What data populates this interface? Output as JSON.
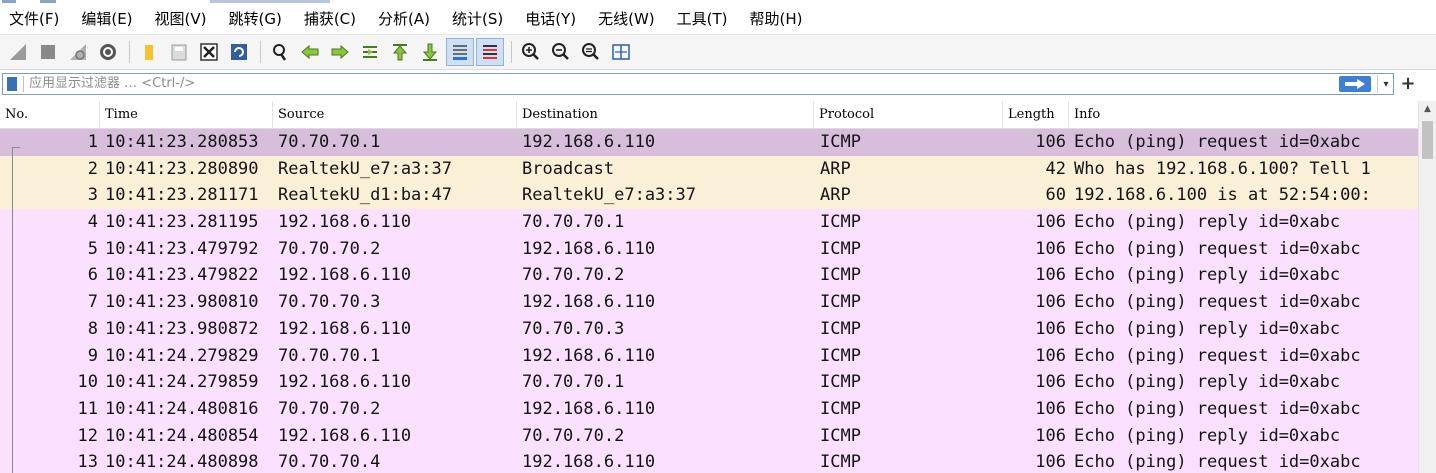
{
  "menu": [
    "文件(F)",
    "编辑(E)",
    "视图(V)",
    "跳转(G)",
    "捕获(C)",
    "分析(A)",
    "统计(S)",
    "电话(Y)",
    "无线(W)",
    "工具(T)",
    "帮助(H)"
  ],
  "toolbar": {
    "buttons": [
      "start-capture-icon",
      "stop-capture-icon",
      "restart-capture-icon",
      "capture-options-icon",
      "open-file-icon",
      "save-file-icon",
      "close-file-icon",
      "reload-file-icon",
      "find-packet-icon",
      "go-back-icon",
      "go-forward-icon",
      "go-to-packet-icon",
      "go-first-icon",
      "go-last-icon",
      "autoscroll-icon",
      "colorize-icon",
      "zoom-in-icon",
      "zoom-out-icon",
      "zoom-normal-icon",
      "resize-columns-icon"
    ]
  },
  "filter": {
    "placeholder": "应用显示过滤器 … <Ctrl-/>"
  },
  "columns": {
    "no": "No.",
    "time": "Time",
    "source": "Source",
    "destination": "Destination",
    "protocol": "Protocol",
    "length": "Length",
    "info": "Info"
  },
  "colors": {
    "selected_row": "#d7bedb",
    "arp_row": "#faf0d7",
    "icmp_row": "#fce0ff"
  },
  "packets": [
    {
      "no": "1",
      "time": "10:41:23.280853",
      "src": "70.70.70.1",
      "dst": "192.168.6.110",
      "proto": "ICMP",
      "len": "106",
      "info": "Echo (ping) request  id=0xabc",
      "kind": "selected"
    },
    {
      "no": "2",
      "time": "10:41:23.280890",
      "src": "RealtekU_e7:a3:37",
      "dst": "Broadcast",
      "proto": "ARP",
      "len": "42",
      "info": "Who has 192.168.6.100? Tell 1",
      "kind": "arp"
    },
    {
      "no": "3",
      "time": "10:41:23.281171",
      "src": "RealtekU_d1:ba:47",
      "dst": "RealtekU_e7:a3:37",
      "proto": "ARP",
      "len": "60",
      "info": "192.168.6.100 is at 52:54:00:",
      "kind": "arp"
    },
    {
      "no": "4",
      "time": "10:41:23.281195",
      "src": "192.168.6.110",
      "dst": "70.70.70.1",
      "proto": "ICMP",
      "len": "106",
      "info": "Echo (ping) reply    id=0xabc",
      "kind": "icmp"
    },
    {
      "no": "5",
      "time": "10:41:23.479792",
      "src": "70.70.70.2",
      "dst": "192.168.6.110",
      "proto": "ICMP",
      "len": "106",
      "info": "Echo (ping) request  id=0xabc",
      "kind": "icmp"
    },
    {
      "no": "6",
      "time": "10:41:23.479822",
      "src": "192.168.6.110",
      "dst": "70.70.70.2",
      "proto": "ICMP",
      "len": "106",
      "info": "Echo (ping) reply    id=0xabc",
      "kind": "icmp"
    },
    {
      "no": "7",
      "time": "10:41:23.980810",
      "src": "70.70.70.3",
      "dst": "192.168.6.110",
      "proto": "ICMP",
      "len": "106",
      "info": "Echo (ping) request  id=0xabc",
      "kind": "icmp"
    },
    {
      "no": "8",
      "time": "10:41:23.980872",
      "src": "192.168.6.110",
      "dst": "70.70.70.3",
      "proto": "ICMP",
      "len": "106",
      "info": "Echo (ping) reply    id=0xabc",
      "kind": "icmp"
    },
    {
      "no": "9",
      "time": "10:41:24.279829",
      "src": "70.70.70.1",
      "dst": "192.168.6.110",
      "proto": "ICMP",
      "len": "106",
      "info": "Echo (ping) request  id=0xabc",
      "kind": "icmp"
    },
    {
      "no": "10",
      "time": "10:41:24.279859",
      "src": "192.168.6.110",
      "dst": "70.70.70.1",
      "proto": "ICMP",
      "len": "106",
      "info": "Echo (ping) reply    id=0xabc",
      "kind": "icmp"
    },
    {
      "no": "11",
      "time": "10:41:24.480816",
      "src": "70.70.70.2",
      "dst": "192.168.6.110",
      "proto": "ICMP",
      "len": "106",
      "info": "Echo (ping) request  id=0xabc",
      "kind": "icmp"
    },
    {
      "no": "12",
      "time": "10:41:24.480854",
      "src": "192.168.6.110",
      "dst": "70.70.70.2",
      "proto": "ICMP",
      "len": "106",
      "info": "Echo (ping) reply    id=0xabc",
      "kind": "icmp"
    },
    {
      "no": "13",
      "time": "10:41:24.480898",
      "src": "70.70.70.4",
      "dst": "192.168.6.110",
      "proto": "ICMP",
      "len": "106",
      "info": "Echo (ping) request  id=0xabc",
      "kind": "icmp"
    }
  ]
}
